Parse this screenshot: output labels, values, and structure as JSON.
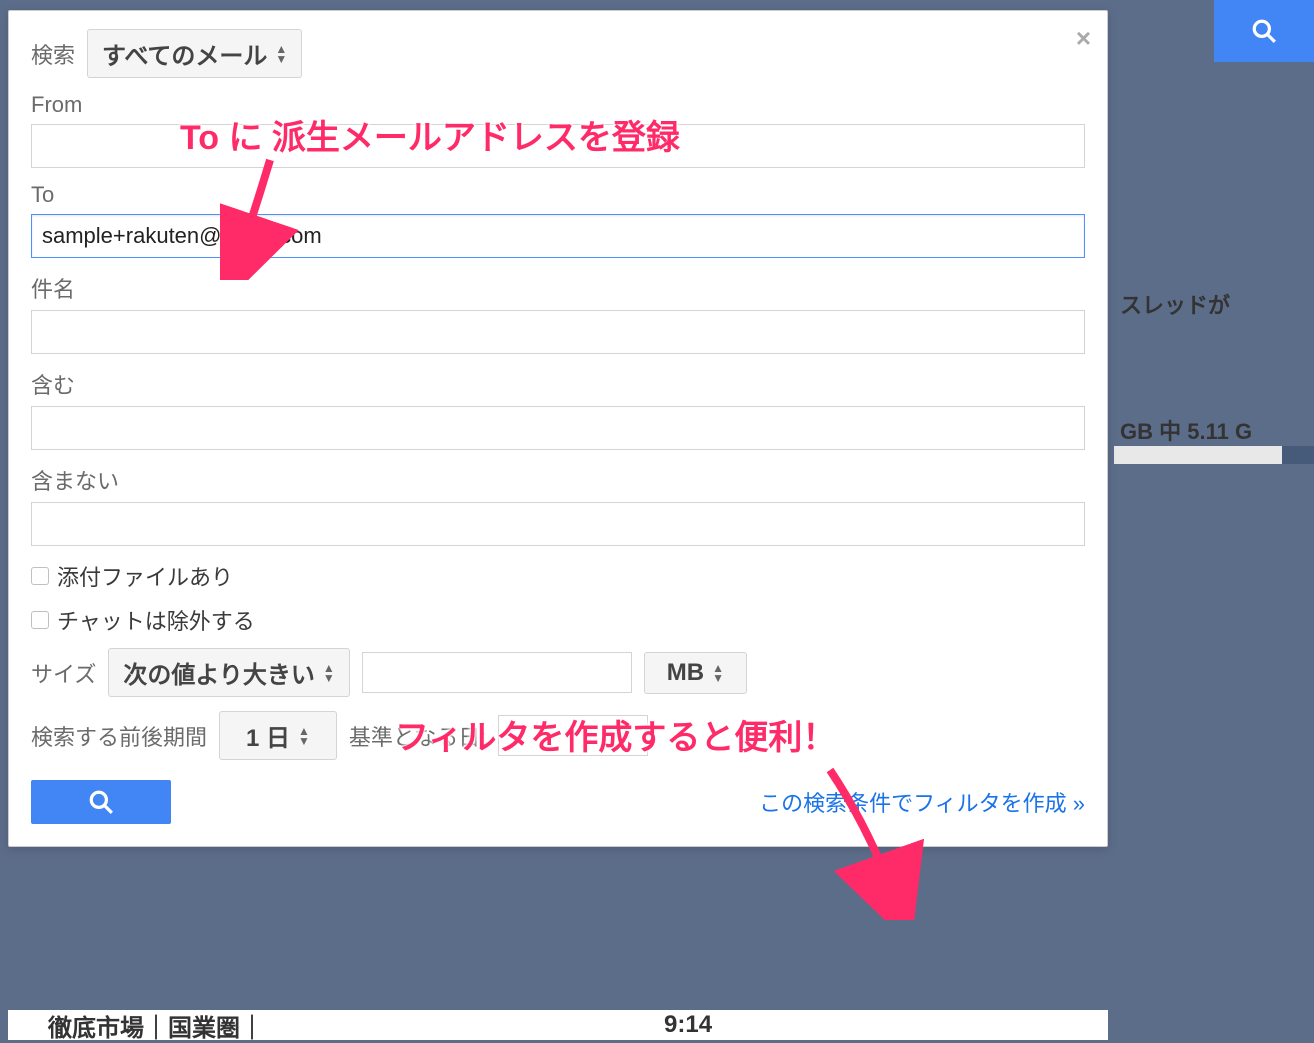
{
  "topSearchButton": {},
  "panel": {
    "scopeLabel": "検索",
    "scopeSelect": "すべてのメール",
    "fromLabel": "From",
    "fromValue": "",
    "toLabel": "To",
    "toValue": "sample+rakuten@gmail.com",
    "subjectLabel": "件名",
    "subjectValue": "",
    "includesLabel": "含む",
    "includesValue": "",
    "excludesLabel": "含まない",
    "excludesValue": "",
    "attachmentLabel": "添付ファイルあり",
    "excludeChatLabel": "チャットは除外する",
    "sizeLabel": "サイズ",
    "sizeComparator": "次の値より大きい",
    "sizeValue": "",
    "sizeUnit": "MB",
    "dateRangeLabel": "検索する前後期間",
    "dateRangeValue": "1 日",
    "dateBaseLabel": "基準となる日:",
    "dateBaseValue": "",
    "createFilterLink": "この検索条件でフィルタを作成 »"
  },
  "annotations": {
    "top": "To に 派生メールアドレスを登録",
    "bottom": "フィルタを作成すると便利！"
  },
  "background": {
    "threadText": "スレッドが",
    "storageText": "GB 中 5.11 G",
    "bottomLeft": "徹底市場｜国業圏｜",
    "bottomTime": "9:14"
  },
  "colors": {
    "accent": "#4285f4",
    "annotation": "#ff2a68",
    "link": "#1a73e8"
  }
}
